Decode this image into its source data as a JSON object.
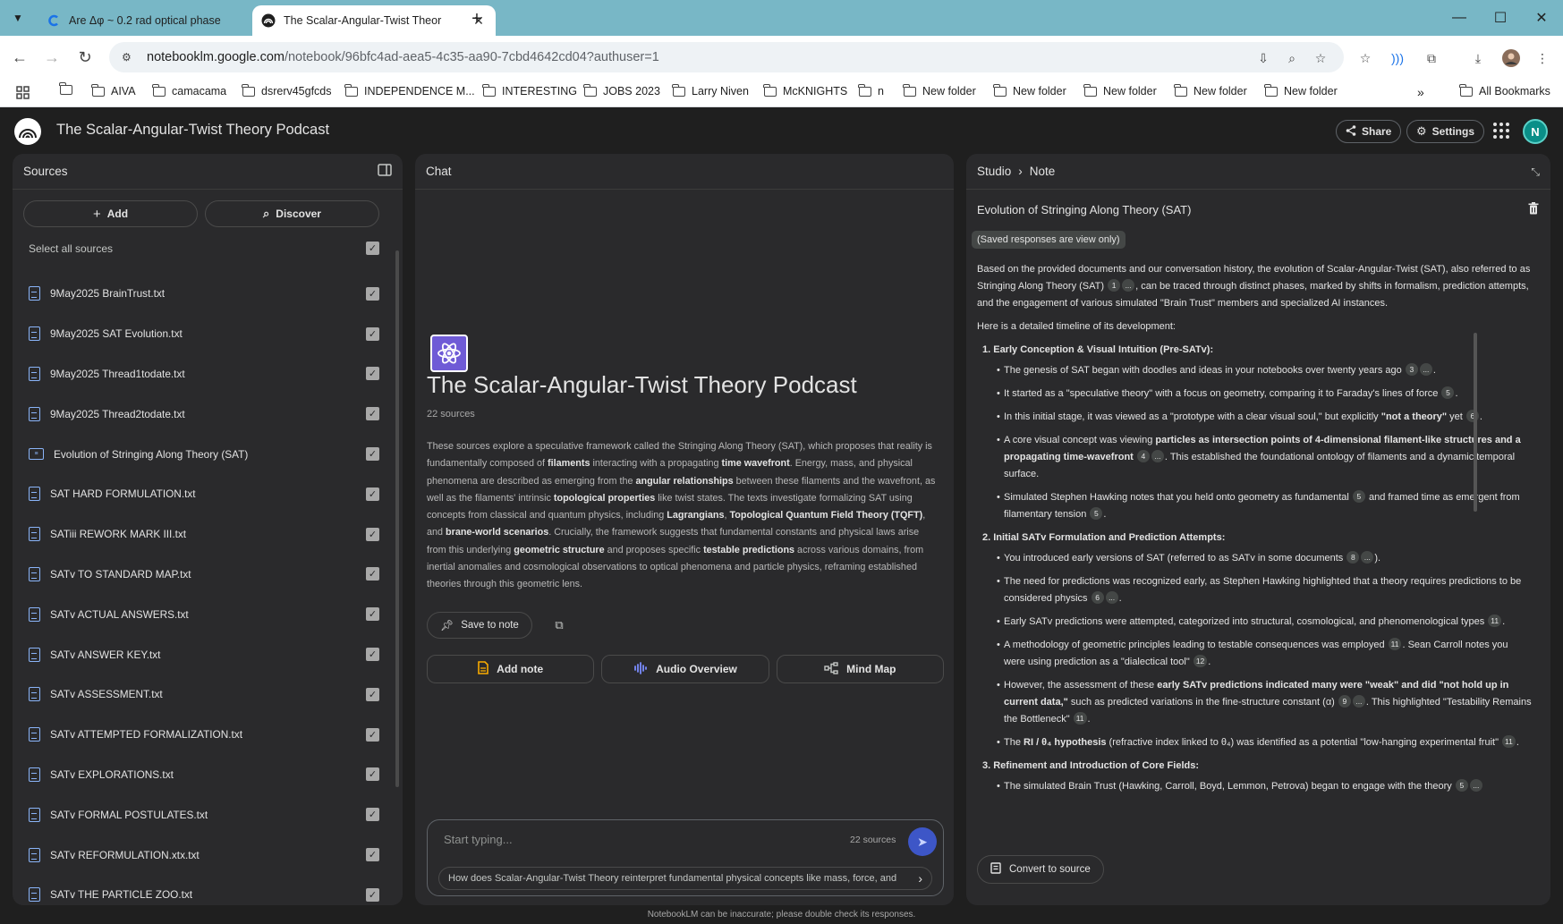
{
  "browser": {
    "tabs": [
      {
        "title": "Are Δφ ~ 0.2 rad optical phase",
        "active": false
      },
      {
        "title": "The Scalar-Angular-Twist Theor",
        "active": true
      }
    ],
    "url_host": "notebooklm.google.com",
    "url_path": "/notebook/96bfc4ad-aea5-4c35-aa90-7cbd4642cd04?authuser=1",
    "bookmarks": [
      "AIVA",
      "camacama",
      "dsrerv45gfcds",
      "INDEPENDENCE M...",
      "INTERESTING",
      "JOBS 2023",
      "Larry Niven",
      "McKNIGHTS",
      "n",
      "New folder",
      "New folder",
      "New folder",
      "New folder",
      "New folder"
    ],
    "all_bookmarks_label": "All Bookmarks"
  },
  "app": {
    "title": "The Scalar-Angular-Twist Theory Podcast",
    "share_label": "Share",
    "settings_label": "Settings",
    "avatar_letter": "N"
  },
  "sources": {
    "header": "Sources",
    "add_label": "Add",
    "discover_label": "Discover",
    "select_all_label": "Select all sources",
    "items": [
      {
        "name": "9May2025 BrainTrust.txt",
        "type": "doc",
        "checked": true
      },
      {
        "name": "9May2025 SAT Evolution.txt",
        "type": "doc",
        "checked": true
      },
      {
        "name": "9May2025 Thread1todate.txt",
        "type": "doc",
        "checked": true
      },
      {
        "name": "9May2025 Thread2todate.txt",
        "type": "doc",
        "checked": true
      },
      {
        "name": "Evolution of Stringing Along Theory (SAT)",
        "type": "note",
        "checked": true
      },
      {
        "name": "SAT HARD FORMULATION.txt",
        "type": "doc",
        "checked": true
      },
      {
        "name": "SATiii REWORK MARK III.txt",
        "type": "doc",
        "checked": true
      },
      {
        "name": "SATv TO STANDARD MAP.txt",
        "type": "doc",
        "checked": true
      },
      {
        "name": "SATv ACTUAL ANSWERS.txt",
        "type": "doc",
        "checked": true
      },
      {
        "name": "SATv ANSWER KEY.txt",
        "type": "doc",
        "checked": true
      },
      {
        "name": "SATv ASSESSMENT.txt",
        "type": "doc",
        "checked": true
      },
      {
        "name": "SATv ATTEMPTED FORMALIZATION.txt",
        "type": "doc",
        "checked": true
      },
      {
        "name": "SATv EXPLORATIONS.txt",
        "type": "doc",
        "checked": true
      },
      {
        "name": "SATv FORMAL POSTULATES.txt",
        "type": "doc",
        "checked": true
      },
      {
        "name": "SATv REFORMULATION.xtx.txt",
        "type": "doc",
        "checked": true
      },
      {
        "name": "SATv THE PARTICLE ZOO.txt",
        "type": "doc",
        "checked": true
      }
    ]
  },
  "chat": {
    "header": "Chat",
    "notebook_title": "The Scalar-Angular-Twist Theory Podcast",
    "source_count": "22 sources",
    "summary": [
      {
        "t": "These sources explore a speculative framework called the Stringing Along Theory (SAT), which proposes that reality is fundamentally composed of ",
        "b": false
      },
      {
        "t": "filaments",
        "b": true
      },
      {
        "t": " interacting with a propagating ",
        "b": false
      },
      {
        "t": "time wavefront",
        "b": true
      },
      {
        "t": ". Energy, mass, and physical phenomena are described as emerging from the ",
        "b": false
      },
      {
        "t": "angular relationships",
        "b": true
      },
      {
        "t": " between these filaments and the wavefront, as well as the filaments' intrinsic ",
        "b": false
      },
      {
        "t": "topological properties",
        "b": true
      },
      {
        "t": " like twist states. The texts investigate formalizing SAT using concepts from classical and quantum physics, including ",
        "b": false
      },
      {
        "t": "Lagrangians",
        "b": true
      },
      {
        "t": ", ",
        "b": false
      },
      {
        "t": "Topological Quantum Field Theory (TQFT)",
        "b": true
      },
      {
        "t": ", and ",
        "b": false
      },
      {
        "t": "brane-world scenarios",
        "b": true
      },
      {
        "t": ". Crucially, the framework suggests that fundamental constants and physical laws arise from this underlying ",
        "b": false
      },
      {
        "t": "geometric structure",
        "b": true
      },
      {
        "t": " and proposes specific ",
        "b": false
      },
      {
        "t": "testable predictions",
        "b": true
      },
      {
        "t": " across various domains, from inertial anomalies and cosmological observations to optical phenomena and particle physics, reframing established theories through this geometric lens.",
        "b": false
      }
    ],
    "save_to_note_label": "Save to note",
    "add_note_label": "Add note",
    "audio_overview_label": "Audio Overview",
    "mind_map_label": "Mind Map",
    "input_placeholder": "Start typing...",
    "input_source_count": "22 sources",
    "suggestion": "How does Scalar-Angular-Twist Theory reinterpret fundamental physical concepts like mass, force, and"
  },
  "studio": {
    "header": "Studio",
    "crumb": "Note",
    "note_title": "Evolution of Stringing Along Theory (SAT)",
    "view_only_label": "(Saved responses are view only)",
    "convert_label": "Convert to source",
    "blocks": [
      {
        "kind": "p",
        "segs": [
          {
            "t": "Based on the provided documents and our conversation history, the evolution of Scalar-Angular-Twist (SAT), also referred to as Stringing Along Theory (SAT) "
          },
          {
            "c": "1"
          },
          {
            "c": "..."
          },
          {
            "t": ", can be traced through distinct phases, marked by shifts in formalism, prediction attempts, and the engagement of various simulated \"Brain Trust\" members and specialized AI instances."
          }
        ]
      },
      {
        "kind": "p",
        "segs": [
          {
            "t": "Here is a detailed timeline of its development:"
          }
        ]
      },
      {
        "kind": "sec",
        "segs": [
          {
            "t": "1. Early Conception & Visual Intuition (Pre-SATv):"
          }
        ]
      },
      {
        "kind": "bul",
        "segs": [
          {
            "t": "The genesis of SAT began with doodles and ideas in your notebooks over twenty years ago "
          },
          {
            "c": "3"
          },
          {
            "c": "..."
          },
          {
            "t": "."
          }
        ]
      },
      {
        "kind": "bul",
        "segs": [
          {
            "t": "It started as a \"speculative theory\" with a focus on geometry, comparing it to Faraday's lines of force "
          },
          {
            "c": "5"
          },
          {
            "t": "."
          }
        ]
      },
      {
        "kind": "bul",
        "segs": [
          {
            "t": "In this initial stage, it was viewed as a \"prototype with a clear visual soul,\" but explicitly "
          },
          {
            "t": "\"not a theory\"",
            "b": true
          },
          {
            "t": " yet "
          },
          {
            "c": "6"
          },
          {
            "t": "."
          }
        ]
      },
      {
        "kind": "bul",
        "segs": [
          {
            "t": "A core visual concept was viewing "
          },
          {
            "t": "particles as intersection points of 4-dimensional filament-like structures and a propagating time-wavefront",
            "b": true
          },
          {
            "t": " "
          },
          {
            "c": "4"
          },
          {
            "c": "..."
          },
          {
            "t": ". This established the foundational ontology of filaments and a dynamic temporal surface."
          }
        ]
      },
      {
        "kind": "bul",
        "segs": [
          {
            "t": "Simulated Stephen Hawking notes that you held onto geometry as fundamental "
          },
          {
            "c": "5"
          },
          {
            "t": " and framed time as emergent from filamentary tension "
          },
          {
            "c": "5"
          },
          {
            "t": "."
          }
        ]
      },
      {
        "kind": "sec",
        "segs": [
          {
            "t": "2. Initial SATv Formulation and Prediction Attempts:"
          }
        ]
      },
      {
        "kind": "bul",
        "segs": [
          {
            "t": "You introduced early versions of SAT (referred to as SATv in some documents "
          },
          {
            "c": "8"
          },
          {
            "c": "..."
          },
          {
            "t": ")."
          }
        ]
      },
      {
        "kind": "bul",
        "segs": [
          {
            "t": "The need for predictions was recognized early, as Stephen Hawking highlighted that a theory requires predictions to be considered physics "
          },
          {
            "c": "6"
          },
          {
            "c": "..."
          },
          {
            "t": "."
          }
        ]
      },
      {
        "kind": "bul",
        "segs": [
          {
            "t": "Early SATv predictions were attempted, categorized into structural, cosmological, and phenomenological types "
          },
          {
            "c": "11"
          },
          {
            "t": "."
          }
        ]
      },
      {
        "kind": "bul",
        "segs": [
          {
            "t": "A methodology of geometric principles leading to testable consequences was employed "
          },
          {
            "c": "11"
          },
          {
            "t": ". Sean Carroll notes you were using prediction as a \"dialectical tool\" "
          },
          {
            "c": "12"
          },
          {
            "t": "."
          }
        ]
      },
      {
        "kind": "bul",
        "segs": [
          {
            "t": "However, the assessment of these "
          },
          {
            "t": "early SATv predictions indicated many were \"weak\" and did \"not hold up in current data,\"",
            "b": true
          },
          {
            "t": " such as predicted variations in the fine-structure constant (α) "
          },
          {
            "c": "9"
          },
          {
            "c": "..."
          },
          {
            "t": ". This highlighted \"Testability Remains the Bottleneck\" "
          },
          {
            "c": "11"
          },
          {
            "t": "."
          }
        ]
      },
      {
        "kind": "bul",
        "segs": [
          {
            "t": "The "
          },
          {
            "t": "RI / θ₄ hypothesis",
            "b": true
          },
          {
            "t": " (refractive index linked to θ₄) was identified as a potential \"low-hanging experimental fruit\" "
          },
          {
            "c": "11"
          },
          {
            "t": "."
          }
        ]
      },
      {
        "kind": "sec",
        "segs": [
          {
            "t": "3. Refinement and Introduction of Core Fields:"
          }
        ]
      },
      {
        "kind": "bul",
        "segs": [
          {
            "t": "The simulated Brain Trust (Hawking, Carroll, Boyd, Lemmon, Petrova) began to engage with the theory "
          },
          {
            "c": "5"
          },
          {
            "c": "..."
          }
        ]
      }
    ]
  },
  "footer": "NotebookLM can be inaccurate; please double check its responses.",
  "colors": {
    "tabbar": "#78b7c6",
    "app_bg": "#1f1f1f",
    "panel_bg": "#2a2a2c",
    "accent_blue": "#8ab4f8",
    "send_button": "#3d56c7",
    "avatar": "#0a8f88"
  }
}
